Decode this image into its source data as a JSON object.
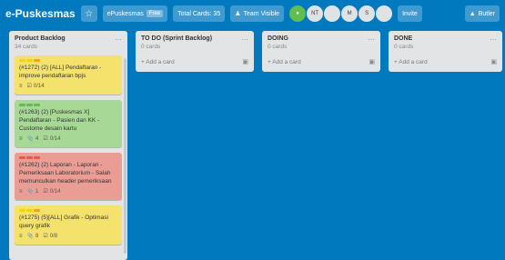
{
  "header": {
    "board_title": "e-Puskesmas",
    "star_icon": "star-icon",
    "team_name": "ePuskesmas",
    "team_tag": "Free",
    "total_cards": "Total Cards: 35",
    "visibility": "Team Visible",
    "members": [
      "NT",
      "M",
      "S"
    ],
    "invite": "Invite",
    "butler": "Butler"
  },
  "lists": [
    {
      "title": "Product Backlog",
      "count": "34 cards",
      "cards": [
        {
          "color": "yellow",
          "labels": [
            "#f2d600",
            "#f2d600",
            "#ff9f1a"
          ],
          "title": "(#1272) (2) [ALL] Pendaftaran - improve pendaftaran bpjs",
          "badges": {
            "description": true,
            "checklist": "0/14"
          }
        },
        {
          "color": "green",
          "labels": [
            "#61bd4f",
            "#61bd4f",
            "#61bd4f"
          ],
          "title": "(#1263) (2) [Puskesmas X] Pendaftaran - Pasien dan KK - Custome desain kartu",
          "badges": {
            "description": true,
            "attachments": "4",
            "checklist": "0/14"
          }
        },
        {
          "color": "red",
          "labels": [
            "#eb5a46",
            "#eb5a46",
            "#eb5a46"
          ],
          "title": "(#1262) (2) Laporan - Laporan - Pemeriksaan Laboratorium - Salah memunculkan header pemeriksaan",
          "badges": {
            "description": true,
            "attachments": "1",
            "checklist": "0/14"
          }
        },
        {
          "color": "yellow",
          "labels": [
            "#f2d600",
            "#f2d600",
            "#ff9f1a"
          ],
          "title": "(#1275) (5)[ALL] Grafik - Optimasi query grafik",
          "badges": {
            "description": true,
            "attachments": "8",
            "checklist": "0/8"
          }
        }
      ]
    },
    {
      "title": "TO DO (Sprint Backlog)",
      "count": "0 cards",
      "add": "+ Add a card"
    },
    {
      "title": "DOING",
      "count": "0 cards",
      "add": "+ Add a card"
    },
    {
      "title": "DONE",
      "count": "0 cards",
      "add": "+ Add a card"
    }
  ]
}
